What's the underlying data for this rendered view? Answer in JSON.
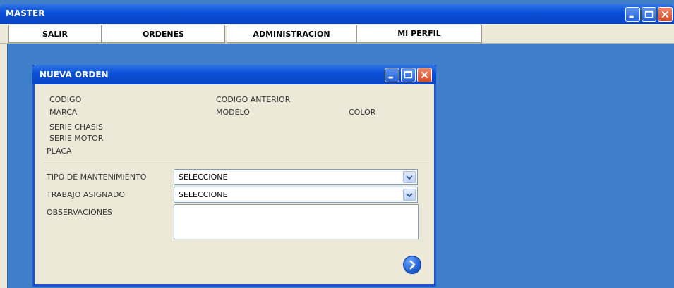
{
  "window": {
    "title": "MASTER"
  },
  "menu": [
    {
      "label": "SALIR"
    },
    {
      "label": "ORDENES"
    },
    {
      "label": "ADMINISTRACION"
    },
    {
      "label": "MI PERFIL"
    }
  ],
  "dialog": {
    "title": "NUEVA ORDEN",
    "labels": {
      "codigo": "CODIGO",
      "codigo_anterior": "CODIGO ANTERIOR",
      "marca": "MARCA",
      "modelo": "MODELO",
      "color": "COLOR",
      "serie_chasis": "SERIE CHASIS",
      "serie_motor": "SERIE MOTOR",
      "placa": "PLACA",
      "tipo_mantenimiento": "TIPO DE MANTENIMIENTO",
      "trabajo_asignado": "TRABAJO ASIGNADO",
      "observaciones": "OBSERVACIONES"
    },
    "tipo_mantenimiento_value": "SELECCIONE",
    "trabajo_asignado_value": "SELECCIONE",
    "observaciones_value": ""
  },
  "icons": {
    "minimize": "minimize-icon",
    "maximize": "maximize-icon",
    "close": "close-icon",
    "dropdown": "chevron-down-icon",
    "next": "arrow-right-circle-icon"
  },
  "colors": {
    "titlebar": "#0a4fd6",
    "desktop": "#3f7fc9",
    "panel": "#ece9d8"
  }
}
